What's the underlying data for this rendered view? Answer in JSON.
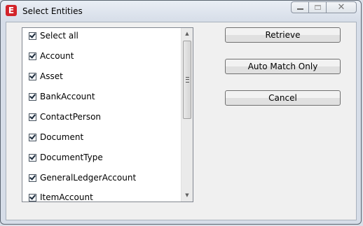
{
  "window": {
    "title": "Select Entities",
    "app_icon_letter": "E",
    "close_glyph": "✕"
  },
  "list": {
    "items": [
      {
        "label": "Select all",
        "checked": true
      },
      {
        "label": "Account",
        "checked": true
      },
      {
        "label": "Asset",
        "checked": true
      },
      {
        "label": "BankAccount",
        "checked": true
      },
      {
        "label": "ContactPerson",
        "checked": true
      },
      {
        "label": "Document",
        "checked": true
      },
      {
        "label": "DocumentType",
        "checked": true
      },
      {
        "label": "GeneralLedgerAccount",
        "checked": true
      },
      {
        "label": "ItemAccount",
        "checked": true
      }
    ],
    "scroll_up_glyph": "▲",
    "scroll_down_glyph": "▼"
  },
  "buttons": {
    "retrieve": "Retrieve",
    "auto_match": "Auto Match Only",
    "cancel": "Cancel"
  }
}
